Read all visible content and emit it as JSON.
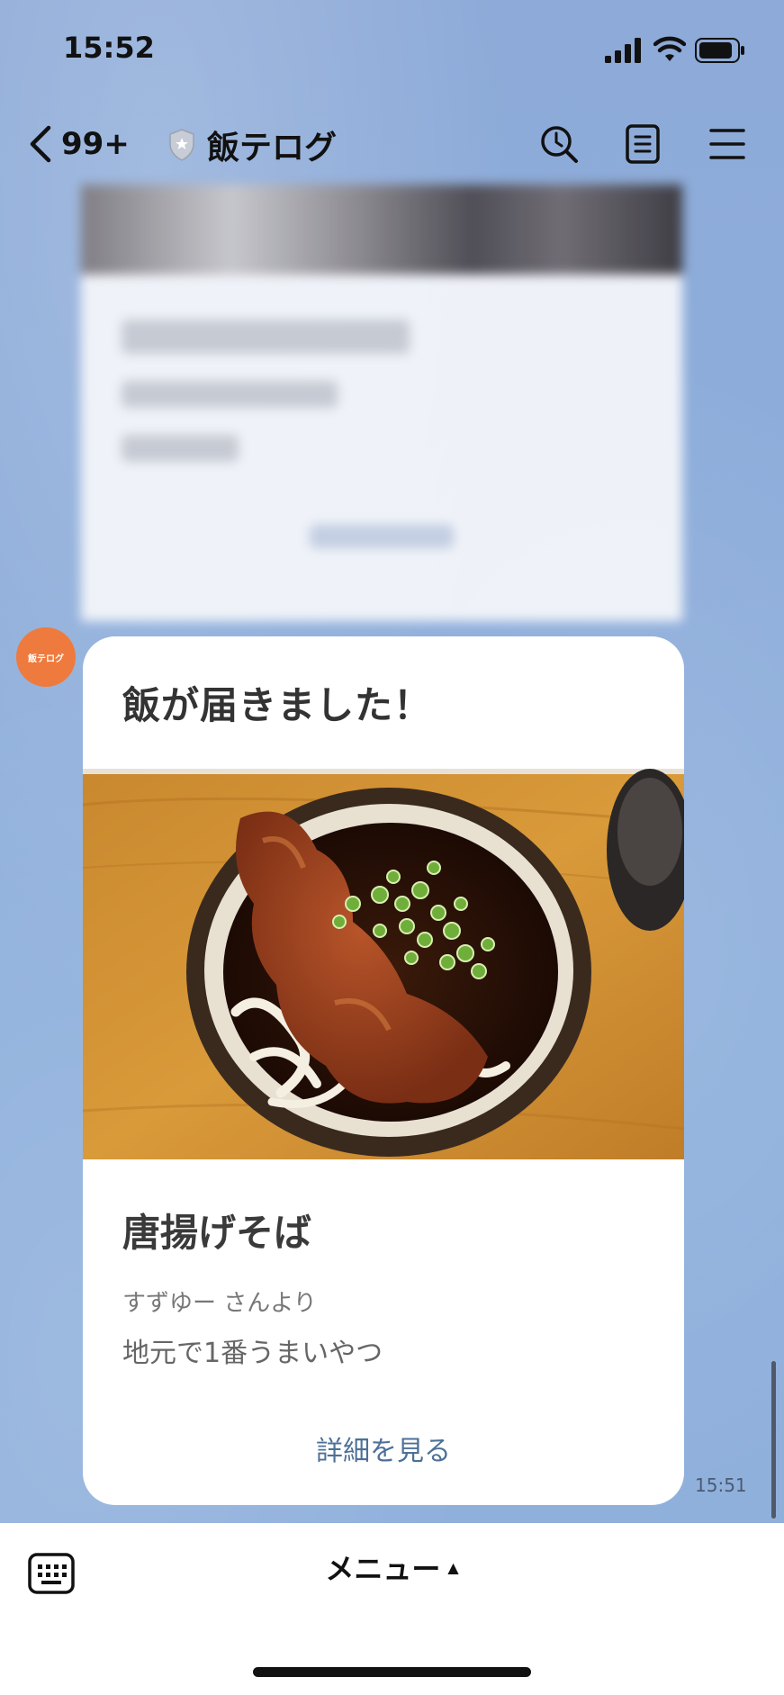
{
  "status_bar": {
    "time": "15:52"
  },
  "header": {
    "back_count": "99+",
    "title": "飯テログ",
    "icons": [
      "search-icon",
      "note-icon",
      "hamburger-menu-icon"
    ]
  },
  "message": {
    "avatar_label": "飯テログ",
    "header_title": "飯が届きました！",
    "dish_name": "唐揚げそば",
    "sender": "すずゆー さんより",
    "comment": "地元で1番うまいやつ",
    "detail_link": "詳細を見る",
    "time": "15:51"
  },
  "bottom_bar": {
    "menu_label": "メニュー",
    "menu_caret": "▲"
  },
  "colors": {
    "chat_background": "#8eacd9",
    "avatar": "#ef7a3d",
    "link": "#4d7098"
  }
}
